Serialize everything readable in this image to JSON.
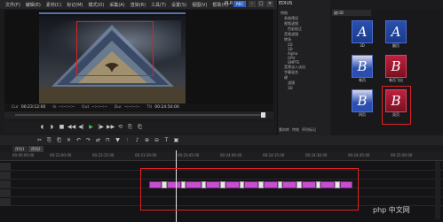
{
  "menu": [
    "文件(F)",
    "编辑(E)",
    "素材(C)",
    "标记(M)",
    "模式(O)",
    "采集(A)",
    "渲染(R)",
    "工具(T)",
    "设置(S)",
    "视图(V)",
    "帮助(H)"
  ],
  "rec_mode": {
    "plr": "PLR",
    "rec": "REC"
  },
  "timecode": {
    "cur_label": "Cur",
    "cur": "00:23:12:00",
    "in_label": "In",
    "in": "--:--:--:--",
    "out_label": "Out",
    "out": "--:--:--:--",
    "dur_label": "Dur",
    "dur": "--:--:--:--",
    "ttl_label": "Ttl",
    "ttl": "00:24:50:00"
  },
  "folder_panel": {
    "title": "EDIUS",
    "tree": [
      "特效",
      "系统预设",
      "视频滤镜",
      "色彩校正",
      "音频滤镜",
      "转场",
      "2D",
      "3D",
      "Alpha",
      "GPU",
      "SMPTE",
      "音频淡入淡出",
      "字幕混合",
      "键",
      "滤镜",
      "3D"
    ],
    "tabs": [
      "素材库",
      "特效",
      "序列标记"
    ]
  },
  "effect_panel": {
    "tab": "键/3D",
    "items": [
      {
        "glyph": "A",
        "label": "3D"
      },
      {
        "glyph": "A",
        "label": "翻页"
      },
      {
        "glyph": "B",
        "label": "卷页"
      },
      {
        "glyph": "B",
        "label": "卷页飞出"
      },
      {
        "glyph": "B",
        "label": "四页"
      },
      {
        "glyph": "B",
        "label": "双页"
      }
    ]
  },
  "timeline": {
    "tabs": [
      "序列1",
      "序列2"
    ],
    "ruler": [
      "00:00:00:00",
      "00:23:00:00",
      "00:23:15:00",
      "00:23:30:00",
      "00:23:45:00",
      "00:24:00:00",
      "00:24:15:00",
      "00:24:30:00",
      "00:24:45:00",
      "00:25:00:00"
    ]
  },
  "watermark": "php 中文网",
  "colors": {
    "accent": "#2f62c8",
    "clip": "#c64fd0",
    "highlight": "#e02020",
    "play": "#3fcf4a"
  }
}
